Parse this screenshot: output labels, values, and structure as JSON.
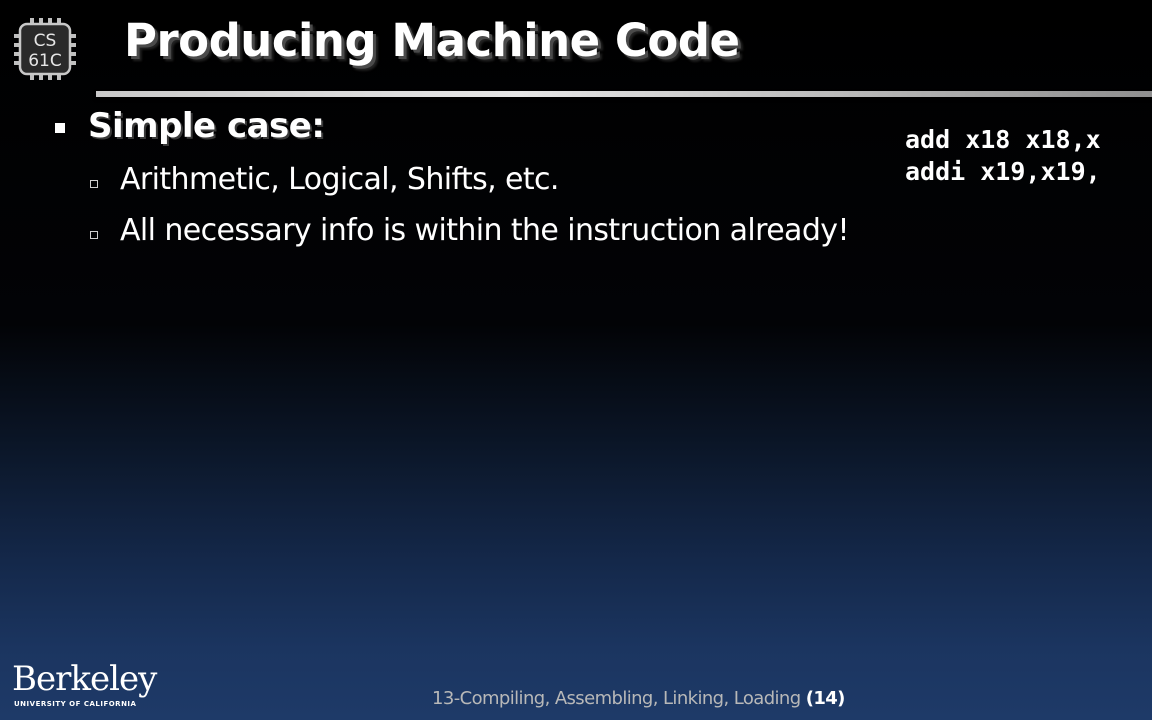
{
  "logo": {
    "line1": "CS",
    "line2": "61C"
  },
  "slide": {
    "title": "Producing Machine Code",
    "bullet": "Simple case:",
    "sub_bullets": [
      "Arithmetic, Logical, Shifts, etc.",
      "All necessary info is within the instruction already!"
    ]
  },
  "code": {
    "lines": [
      "add x18 x18,x",
      "addi x19,x19,"
    ]
  },
  "footer": {
    "institution": "Berkeley",
    "institution_sub": "UNIVERSITY OF CALIFORNIA",
    "lecture": "13-Compiling, Assembling, Linking, Loading",
    "page": "(14)"
  },
  "colors": {
    "background_top": "#000000",
    "background_bottom": "#1e3a68",
    "text": "#ffffff",
    "footer_text": "#b8b8b8"
  }
}
